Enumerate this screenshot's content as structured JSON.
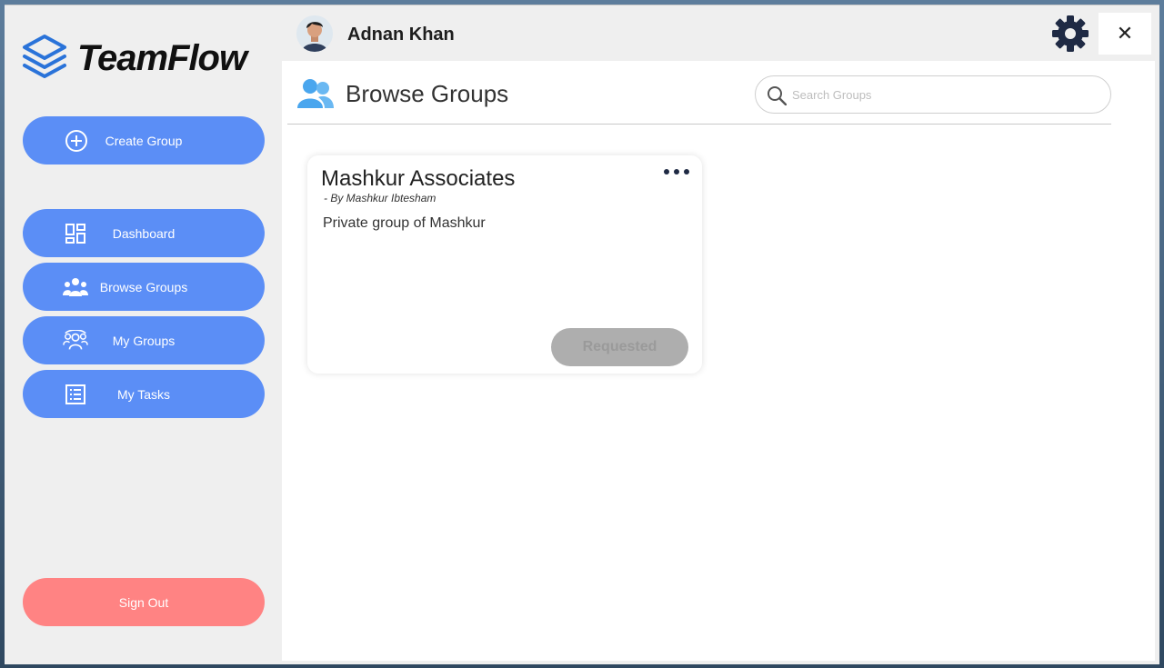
{
  "app": {
    "name": "TeamFlow"
  },
  "user": {
    "name": "Adnan Khan"
  },
  "sidebar": {
    "create_label": "Create Group",
    "items": [
      {
        "label": "Dashboard",
        "icon": "dashboard-icon"
      },
      {
        "label": "Browse Groups",
        "icon": "people-group-icon"
      },
      {
        "label": "My Groups",
        "icon": "my-groups-icon"
      },
      {
        "label": "My Tasks",
        "icon": "task-list-icon"
      }
    ],
    "signout_label": "Sign Out"
  },
  "page": {
    "title": "Browse Groups",
    "search_placeholder": "Search Groups"
  },
  "groups": [
    {
      "name": "Mashkur Associates",
      "author": "- By Mashkur Ibtesham",
      "description": "Private group of Mashkur",
      "status": "Requested"
    }
  ],
  "colors": {
    "accent": "#5b8ef6",
    "signout": "#ff8383",
    "requested_button": "#aeaeae",
    "logo": "#2a73d9",
    "gear": "#1f2a44"
  }
}
